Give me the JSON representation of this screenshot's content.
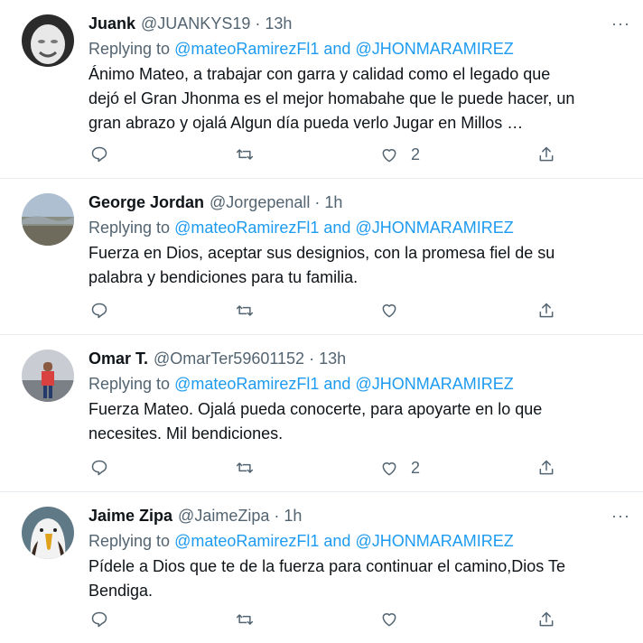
{
  "tweets": [
    {
      "name": "Juank",
      "handle": "@JUANKYS19",
      "time": "13h",
      "replying_prefix": "Replying to",
      "mention1": "@mateoRamirezFl1",
      "and": "and",
      "mention2": "@JHONMARAMIREZ",
      "lines": [
        "Ánimo Mateo, a trabajar con garra y calidad como el legado que",
        "dejó el Gran Jhonma es el mejor homabahe que le puede hacer, un",
        "gran abrazo y ojalá Algun día pueda verlo Jugar en Millos …"
      ],
      "likes": "2"
    },
    {
      "name": "George Jordan",
      "handle": "@Jorgepenall",
      "time": "1h",
      "replying_prefix": "Replying to",
      "mention1": "@mateoRamirezFl1",
      "and": "and",
      "mention2": "@JHONMARAMIREZ",
      "lines": [
        "Fuerza en Dios, aceptar sus designios, con la promesa fiel de su",
        "palabra y bendiciones para tu familia."
      ],
      "likes": ""
    },
    {
      "name": "Omar T.",
      "handle": "@OmarTer59601152",
      "time": "13h",
      "replying_prefix": "Replying to",
      "mention1": "@mateoRamirezFl1",
      "and": "and",
      "mention2": "@JHONMARAMIREZ",
      "lines": [
        "Fuerza Mateo. Ojalá pueda conocerte, para apoyarte en lo que",
        "necesites. Mil bendiciones."
      ],
      "likes": "2"
    },
    {
      "name": "Jaime Zipa",
      "handle": "@JaimeZipa",
      "time": "1h",
      "replying_prefix": "Replying to",
      "mention1": "@mateoRamirezFl1",
      "and": "and",
      "mention2": "@JHONMARAMIREZ",
      "lines": [
        "Pídele a Dios que te de la fuerza para continuar el camino,Dios Te",
        "Bendiga."
      ],
      "likes": ""
    }
  ],
  "more_glyph": "···",
  "dot_glyph": "·",
  "colors": {
    "link": "#1d9bf0",
    "secondary": "#536471",
    "text": "#0f1419",
    "divider": "#e6ecf0"
  }
}
